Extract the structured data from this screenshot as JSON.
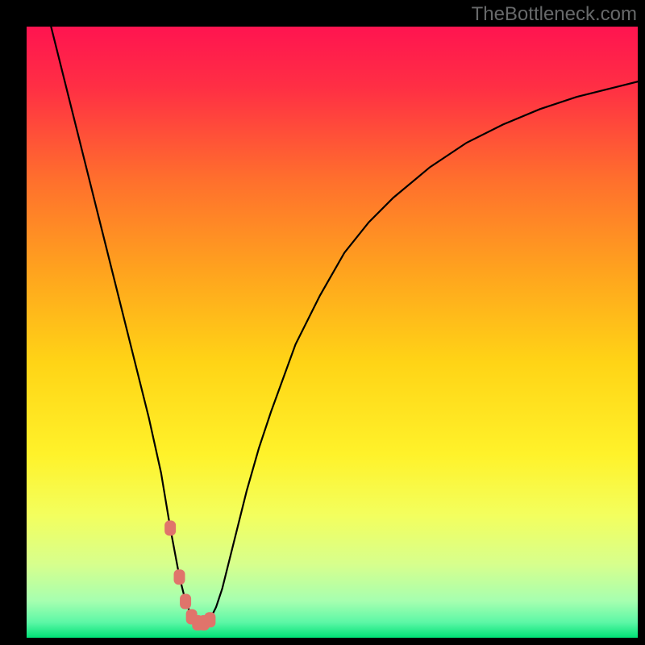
{
  "watermark": "TheBottleneck.com",
  "chart_data": {
    "type": "line",
    "title": "",
    "xlabel": "",
    "ylabel": "",
    "xlim": [
      0,
      100
    ],
    "ylim": [
      0,
      100
    ],
    "series": [
      {
        "name": "bottleneck-curve",
        "x": [
          4,
          6,
          8,
          10,
          12,
          14,
          16,
          18,
          20,
          22,
          23.5,
          25,
          26,
          27,
          28,
          29,
          30,
          31,
          32,
          34,
          36,
          38,
          40,
          44,
          48,
          52,
          56,
          60,
          66,
          72,
          78,
          84,
          90,
          96,
          100
        ],
        "y": [
          100,
          92,
          84,
          76,
          68,
          60,
          52,
          44,
          36,
          27,
          18,
          10,
          6,
          3.5,
          2.5,
          2.5,
          3,
          5,
          8,
          16,
          24,
          31,
          37,
          48,
          56,
          63,
          68,
          72,
          77,
          81,
          84,
          86.5,
          88.5,
          90,
          91
        ]
      }
    ],
    "markers": {
      "name": "highlight-points",
      "color": "#e0746b",
      "x": [
        23.5,
        25,
        26,
        27,
        28,
        29,
        30
      ],
      "y": [
        18,
        10,
        6,
        3.5,
        2.5,
        2.5,
        3,
        5,
        8
      ]
    },
    "gradient_stops": [
      {
        "offset": 0.0,
        "color": "#ff1450"
      },
      {
        "offset": 0.1,
        "color": "#ff2f44"
      },
      {
        "offset": 0.25,
        "color": "#ff6f2d"
      },
      {
        "offset": 0.4,
        "color": "#ffa31e"
      },
      {
        "offset": 0.55,
        "color": "#ffd416"
      },
      {
        "offset": 0.7,
        "color": "#fff22a"
      },
      {
        "offset": 0.8,
        "color": "#f3ff5e"
      },
      {
        "offset": 0.88,
        "color": "#d7ff8d"
      },
      {
        "offset": 0.94,
        "color": "#a6ffb0"
      },
      {
        "offset": 0.975,
        "color": "#5cf7a6"
      },
      {
        "offset": 1.0,
        "color": "#00e176"
      }
    ]
  }
}
